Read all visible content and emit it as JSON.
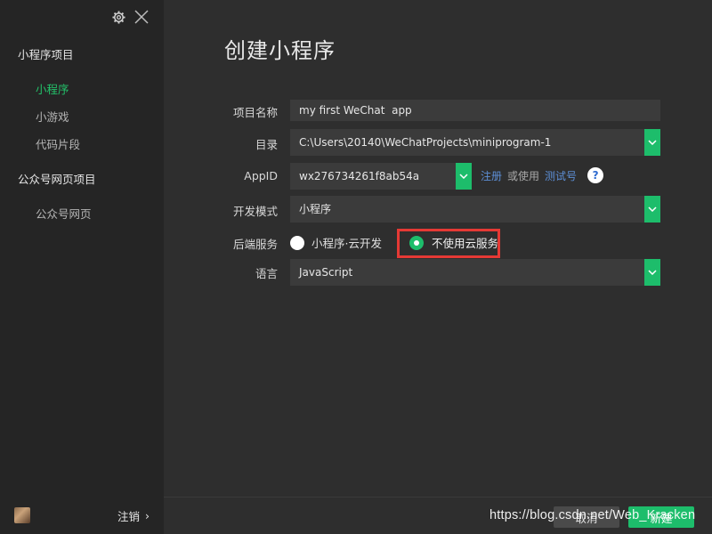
{
  "sidebar": {
    "groups": [
      {
        "title": "小程序项目",
        "items": [
          "小程序",
          "小游戏",
          "代码片段"
        ]
      },
      {
        "title": "公众号网页项目",
        "items": [
          "公众号网页"
        ]
      }
    ],
    "footer": {
      "logout_label": "注销",
      "chevron": "›"
    }
  },
  "main": {
    "title": "创建小程序",
    "fields": {
      "project_name": {
        "label": "项目名称",
        "value": "my first WeChat  app"
      },
      "directory": {
        "label": "目录",
        "value": "C:\\Users\\20140\\WeChatProjects\\miniprogram-1"
      },
      "appid": {
        "label": "AppID",
        "value": "wx276734261f8ab54a",
        "register": "注册",
        "or_use": "或使用",
        "test_account": "测试号",
        "help": "?"
      },
      "dev_mode": {
        "label": "开发模式",
        "value": "小程序"
      },
      "backend": {
        "label": "后端服务",
        "options": [
          "小程序·云开发",
          "不使用云服务"
        ],
        "selected": 1
      },
      "language": {
        "label": "语言",
        "value": "JavaScript"
      }
    },
    "buttons": {
      "cancel": "取消",
      "create": "新建"
    }
  },
  "watermark": "https://blog.csdn.net/Web_Kracken",
  "colors": {
    "accent": "#1dbd6b",
    "highlight": "#e53935",
    "link": "#5d8fd6"
  }
}
